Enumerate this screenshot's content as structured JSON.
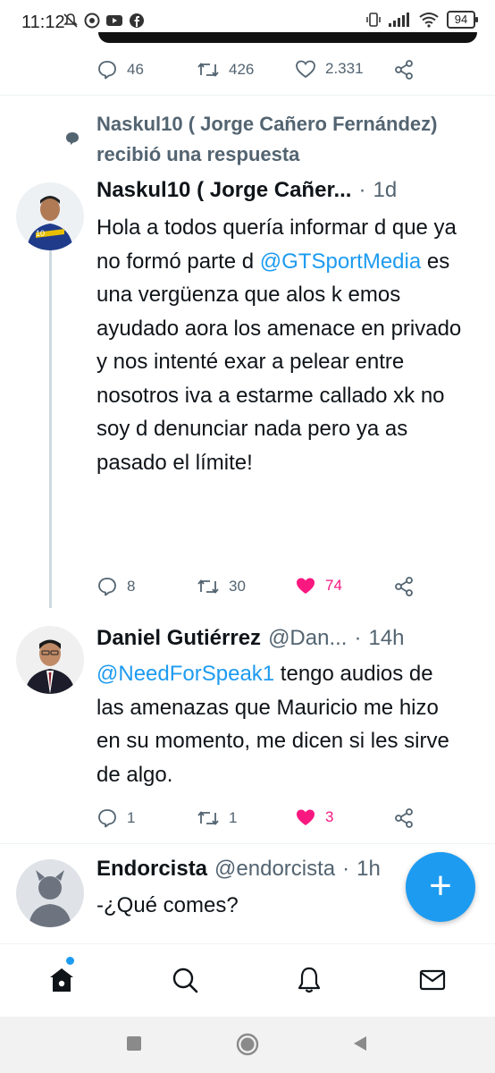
{
  "status_bar": {
    "time": "11:12",
    "battery": "94",
    "icons": [
      "mute-icon",
      "chrome-icon",
      "youtube-icon",
      "facebook-icon",
      "vibrate-icon",
      "signal-icon",
      "wifi-icon",
      "battery-icon"
    ]
  },
  "top_tweet_actions": {
    "replies": "46",
    "retweets": "426",
    "likes": "2.331"
  },
  "context": {
    "text": "Naskul10 ( Jorge Cañero Fernández) recibió una respuesta"
  },
  "tweets": [
    {
      "name": "Naskul10 ( Jorge Cañer...",
      "separator": "·",
      "time": "1d",
      "body_before": "Hola a todos quería informar d que ya no formó parte d ",
      "mention": "@GTSportMedia",
      "body_after": " es una vergüenza que alos k emos ayudado aora los  amenace en privado y nos intenté exar a pelear entre nosotros iva a estarme callado xk no soy d denunciar nada pero ya as pasado el límite!",
      "replies": "8",
      "retweets": "30",
      "likes": "74"
    },
    {
      "name": "Daniel Gutiérrez",
      "handle": "@Dan...",
      "separator": "·",
      "time": "14h",
      "mention": "@NeedForSpeak1",
      "body_after": " tengo audios de las amenazas que Mauricio me hizo en su momento, me dicen si les sirve de algo.",
      "replies": "1",
      "retweets": "1",
      "likes": "3"
    },
    {
      "name": "Endorcista",
      "handle": "@endorcista",
      "separator": "·",
      "time": "1h",
      "body": "-¿Qué comes?"
    }
  ],
  "fab": {
    "label": "+"
  },
  "colors": {
    "accent": "#1d9bf0",
    "like": "#f91880",
    "muted": "#536471"
  }
}
